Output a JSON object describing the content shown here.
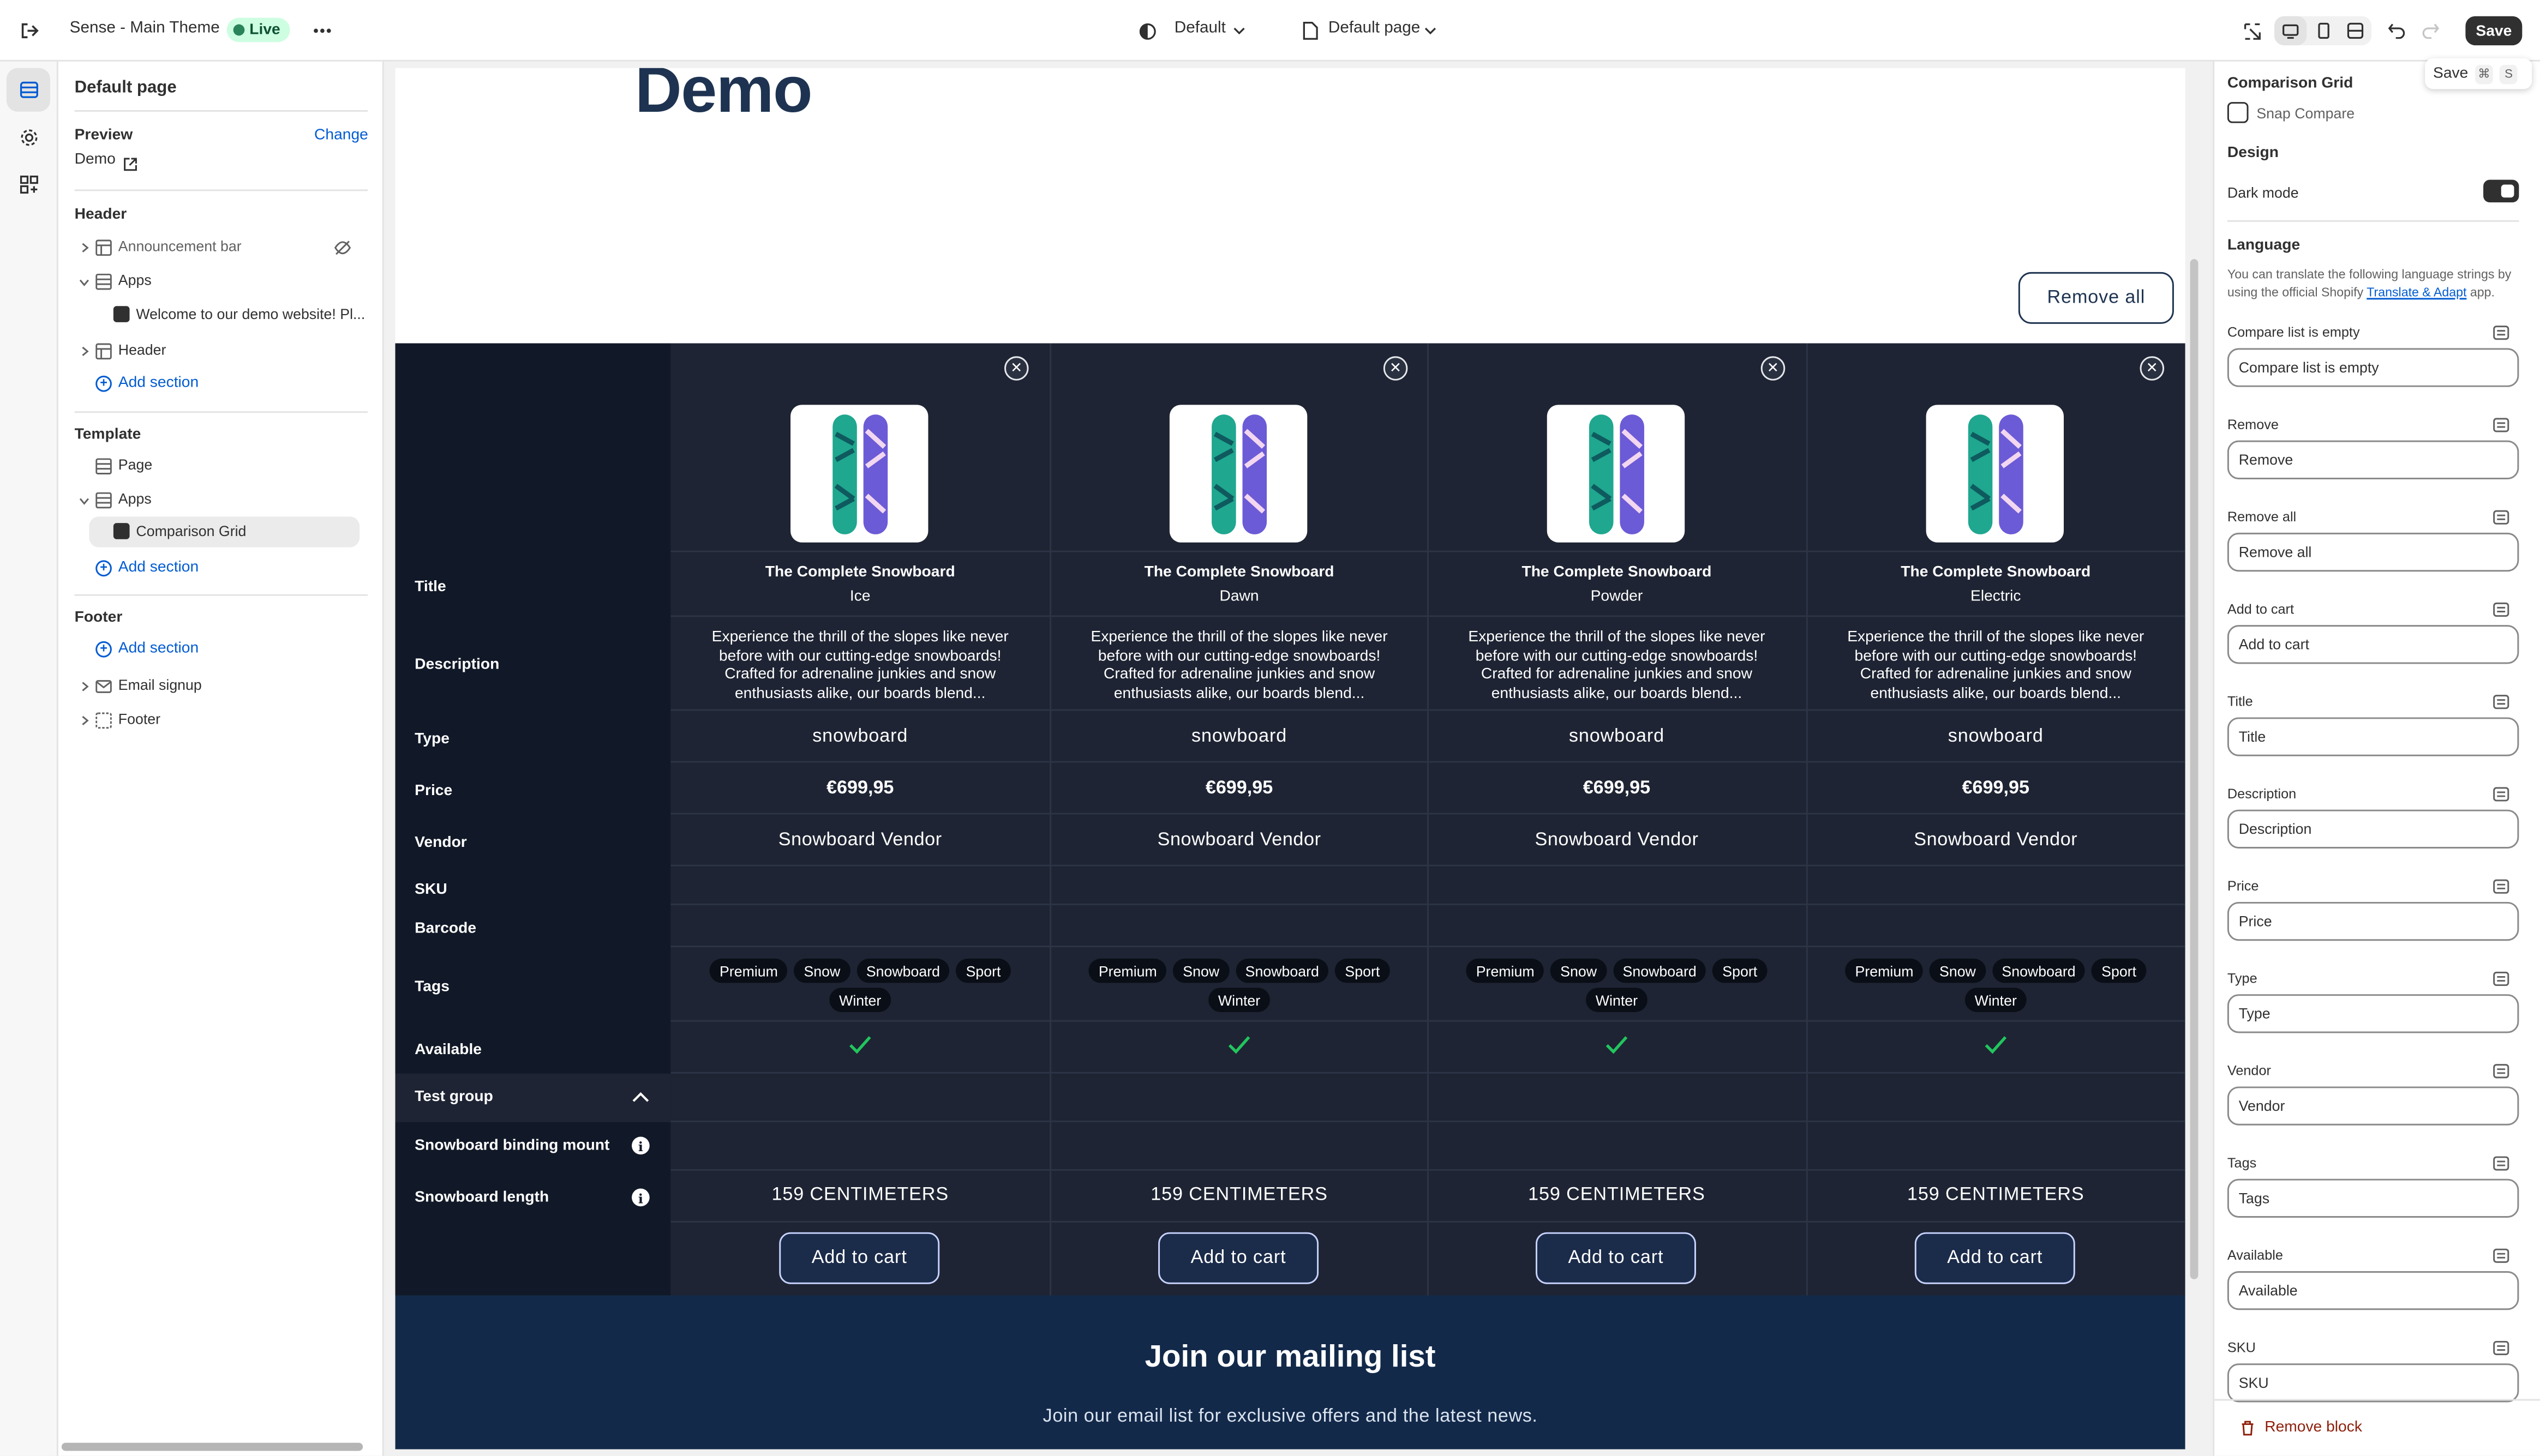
{
  "topbar": {
    "theme_name": "Sense - Main Theme",
    "live_badge": "Live",
    "theme_selector": "Default",
    "page_selector": "Default page",
    "save_label": "Save",
    "tooltip_label": "Save",
    "tooltip_key1": "⌘",
    "tooltip_key2": "S"
  },
  "left": {
    "title": "Default page",
    "preview_label": "Preview",
    "change_label": "Change",
    "preview_value": "Demo",
    "header_group": "Header",
    "header_items": [
      "Announcement bar",
      "Apps",
      "Welcome to our demo website! Pl...",
      "Header"
    ],
    "add_section": "Add section",
    "template_group": "Template",
    "template_items": [
      "Page",
      "Apps",
      "Comparison Grid"
    ],
    "footer_group": "Footer",
    "footer_items": [
      "Email signup",
      "Footer"
    ]
  },
  "preview": {
    "demo_title": "Demo",
    "remove_all": "Remove all",
    "row_labels": {
      "title": "Title",
      "description": "Description",
      "type": "Type",
      "price": "Price",
      "vendor": "Vendor",
      "sku": "SKU",
      "barcode": "Barcode",
      "tags": "Tags",
      "available": "Available",
      "test_group": "Test group",
      "binding": "Snowboard binding mount",
      "length": "Snowboard length"
    },
    "products": [
      {
        "name": "The Complete Snowboard",
        "variant": "Ice",
        "description": "Experience the thrill of the slopes like never before with our cutting-edge snowboards! Crafted for adrenaline junkies and snow enthusiasts alike, our boards blend...",
        "type": "snowboard",
        "price": "€699,95",
        "vendor": "Snowboard Vendor",
        "tags": [
          "Premium",
          "Snow",
          "Snowboard",
          "Sport",
          "Winter"
        ],
        "length": "159 CENTIMETERS",
        "add_to_cart": "Add to cart"
      },
      {
        "name": "The Complete Snowboard",
        "variant": "Dawn",
        "description": "Experience the thrill of the slopes like never before with our cutting-edge snowboards! Crafted for adrenaline junkies and snow enthusiasts alike, our boards blend...",
        "type": "snowboard",
        "price": "€699,95",
        "vendor": "Snowboard Vendor",
        "tags": [
          "Premium",
          "Snow",
          "Snowboard",
          "Sport",
          "Winter"
        ],
        "length": "159 CENTIMETERS",
        "add_to_cart": "Add to cart"
      },
      {
        "name": "The Complete Snowboard",
        "variant": "Powder",
        "description": "Experience the thrill of the slopes like never before with our cutting-edge snowboards! Crafted for adrenaline junkies and snow enthusiasts alike, our boards blend...",
        "type": "snowboard",
        "price": "€699,95",
        "vendor": "Snowboard Vendor",
        "tags": [
          "Premium",
          "Snow",
          "Snowboard",
          "Sport",
          "Winter"
        ],
        "length": "159 CENTIMETERS",
        "add_to_cart": "Add to cart"
      },
      {
        "name": "The Complete Snowboard",
        "variant": "Electric",
        "description": "Experience the thrill of the slopes like never before with our cutting-edge snowboards! Crafted for adrenaline junkies and snow enthusiasts alike, our boards blend...",
        "type": "snowboard",
        "price": "€699,95",
        "vendor": "Snowboard Vendor",
        "tags": [
          "Premium",
          "Snow",
          "Snowboard",
          "Sport",
          "Winter"
        ],
        "length": "159 CENTIMETERS",
        "add_to_cart": "Add to cart"
      }
    ],
    "mailing_title": "Join our mailing list",
    "mailing_sub": "Join our email list for exclusive offers and the latest news."
  },
  "right": {
    "block_title": "Comparison Grid",
    "app_name": "Snap Compare",
    "design_heading": "Design",
    "dark_mode_label": "Dark mode",
    "dark_mode_on": true,
    "language_heading": "Language",
    "language_help_1": "You can translate the following language strings by",
    "language_help_2": "using the official Shopify",
    "language_link": "Translate & Adapt",
    "language_help_3": "app.",
    "fields": [
      {
        "label": "Compare list is empty",
        "value": "Compare list is empty"
      },
      {
        "label": "Remove",
        "value": "Remove"
      },
      {
        "label": "Remove all",
        "value": "Remove all"
      },
      {
        "label": "Add to cart",
        "value": "Add to cart"
      },
      {
        "label": "Title",
        "value": "Title"
      },
      {
        "label": "Description",
        "value": "Description"
      },
      {
        "label": "Price",
        "value": "Price"
      },
      {
        "label": "Type",
        "value": "Type"
      },
      {
        "label": "Vendor",
        "value": "Vendor"
      },
      {
        "label": "Tags",
        "value": "Tags"
      },
      {
        "label": "Available",
        "value": "Available"
      },
      {
        "label": "SKU",
        "value": "SKU"
      }
    ],
    "remove_block": "Remove block"
  },
  "colors": {
    "accent": "#005bd3",
    "grid_bg": "#1e2433",
    "grid_label_bg": "#111827",
    "check": "#22c55e",
    "mailing_bg": "#12294a",
    "demo_title": "#1e3351"
  }
}
